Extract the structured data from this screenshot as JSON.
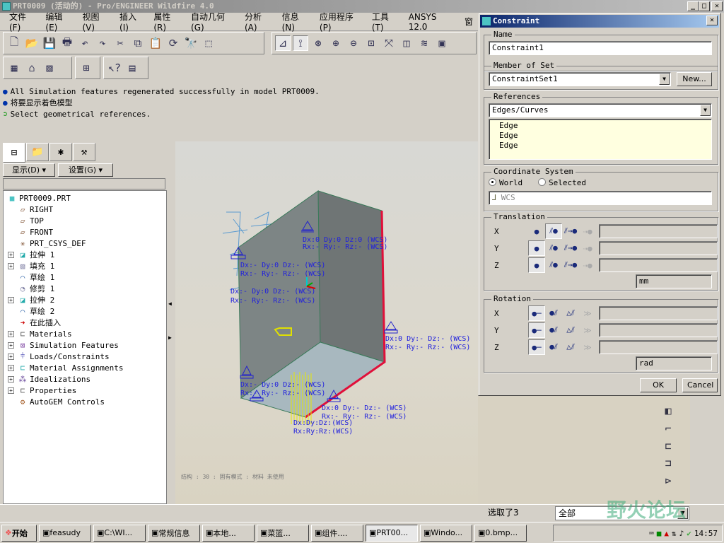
{
  "window": {
    "title": "PRT0009 (活动的) - Pro/ENGINEER Wildfire 4.0",
    "min": "_",
    "max": "□",
    "close": "✕"
  },
  "menu": [
    "文件(F)",
    "编辑(E)",
    "视图(V)",
    "插入(I)",
    "属性(R)",
    "自动几何(G)",
    "分析(A)",
    "信息(N)",
    "应用程序(P)",
    "工具(T)",
    "ANSYS 12.0",
    "窗"
  ],
  "messages": [
    {
      "icon": "bullet-icon",
      "text": "All Simulation features regenerated successfully in model PRT0009."
    },
    {
      "icon": "bullet-icon",
      "text": "将要显示着色模型"
    },
    {
      "icon": "green-arrow-icon",
      "text": "Select geometrical references."
    }
  ],
  "tree_buttons": {
    "show": "显示(D) ▾",
    "settings": "设置(G) ▾"
  },
  "tree": [
    {
      "label": "PRT0009.PRT",
      "icon": "part-icon",
      "expand": false,
      "indent": 0
    },
    {
      "label": "RIGHT",
      "icon": "datum-plane-icon",
      "expand": false,
      "indent": 1
    },
    {
      "label": "TOP",
      "icon": "datum-plane-icon",
      "expand": false,
      "indent": 1
    },
    {
      "label": "FRONT",
      "icon": "datum-plane-icon",
      "expand": false,
      "indent": 1
    },
    {
      "label": "PRT_CSYS_DEF",
      "icon": "csys-icon",
      "expand": false,
      "indent": 1
    },
    {
      "label": "拉伸 1",
      "icon": "extrude-icon",
      "expand": true,
      "indent": 1
    },
    {
      "label": "填充 1",
      "icon": "fill-icon",
      "expand": true,
      "indent": 1
    },
    {
      "label": "草绘 1",
      "icon": "sketch-icon",
      "expand": false,
      "indent": 1
    },
    {
      "label": "修剪 1",
      "icon": "trim-icon",
      "expand": false,
      "indent": 1
    },
    {
      "label": "拉伸 2",
      "icon": "extrude-icon",
      "expand": true,
      "indent": 1
    },
    {
      "label": "草绘 2",
      "icon": "sketch-icon",
      "expand": false,
      "indent": 1
    },
    {
      "label": "在此插入",
      "icon": "insert-arrow-icon",
      "expand": false,
      "indent": 1
    },
    {
      "label": "Materials",
      "icon": "folder-icon",
      "expand": true,
      "indent": 1
    },
    {
      "label": "Simulation Features",
      "icon": "simulation-icon",
      "expand": true,
      "indent": 1
    },
    {
      "label": "Loads/Constraints",
      "icon": "loads-icon",
      "expand": true,
      "indent": 1
    },
    {
      "label": "Material Assignments",
      "icon": "material-assign-icon",
      "expand": true,
      "indent": 1
    },
    {
      "label": "Idealizations",
      "icon": "idealization-icon",
      "expand": true,
      "indent": 1
    },
    {
      "label": "Properties",
      "icon": "folder-icon",
      "expand": true,
      "indent": 1
    },
    {
      "label": "AutoGEM Controls",
      "icon": "autogem-icon",
      "expand": false,
      "indent": 1
    }
  ],
  "annotations": [
    {
      "l1": "Dx:0 Dy:0 Dz:0 (WCS)",
      "l2": "Rx:- Ry:- Rz:- (WCS)"
    },
    {
      "l1": "Dx:- Dy:0 Dz:- (WCS)",
      "l2": "Rx:- Ry:- Rz:- (WCS)"
    },
    {
      "l1": "Dx:0 Dy:- Dz:- (WCS)",
      "l2": "Rx:- Ry:- Rz:- (WCS)"
    },
    {
      "l1": "Dx:- Dy:0 Dz:- (WCS)",
      "l2": "Rx:- Ry:- Rz:- (WCS)"
    },
    {
      "l1": "Dx:0 Dy:- Dz:- (WCS)",
      "l2": "Rx:- Ry:- Rz:- (WCS)"
    },
    {
      "l1": "Dx:Dy:Dz:(WCS)",
      "l2": "Rx:Ry:Rz:(WCS)"
    }
  ],
  "gfx_status": "结构 : 30 : 固有模式 : 材料 未使用",
  "dialog": {
    "title": "Constraint",
    "name_label": "Name",
    "name_value": "Constraint1",
    "set_label": "Member of Set",
    "set_value": "ConstraintSet1",
    "new_button": "New...",
    "refs_label": "References",
    "refs_type": "Edges/Curves",
    "refs_items": [
      "Edge",
      "Edge",
      "Edge"
    ],
    "csys_label": "Coordinate System",
    "csys_world": "World",
    "csys_selected": "Selected",
    "csys_value": "WCS",
    "csys_mode": "World",
    "translation_label": "Translation",
    "rotation_label": "Rotation",
    "translation": [
      {
        "axis": "X",
        "state": "fixed"
      },
      {
        "axis": "Y",
        "state": "free"
      },
      {
        "axis": "Z",
        "state": "free"
      }
    ],
    "rotation": [
      {
        "axis": "X",
        "state": "free"
      },
      {
        "axis": "Y",
        "state": "free"
      },
      {
        "axis": "Z",
        "state": "free"
      }
    ],
    "trans_units": "mm",
    "rot_units": "rad",
    "ok": "OK",
    "cancel": "Cancel"
  },
  "status": {
    "selected": "选取了3",
    "filter": "全部"
  },
  "watermark": "野火论坛",
  "taskbar": {
    "start": "开始",
    "tasks": [
      {
        "label": "feasudy",
        "active": false
      },
      {
        "label": "C:\\WI...",
        "active": false
      },
      {
        "label": "常规信息",
        "active": false
      },
      {
        "label": "本地...",
        "active": false
      },
      {
        "label": "菜篮...",
        "active": false
      },
      {
        "label": "组件....",
        "active": false
      },
      {
        "label": "PRT00...",
        "active": true
      },
      {
        "label": "Windo...",
        "active": false
      },
      {
        "label": "0.bmp...",
        "active": false
      }
    ],
    "clock": "14:57"
  }
}
